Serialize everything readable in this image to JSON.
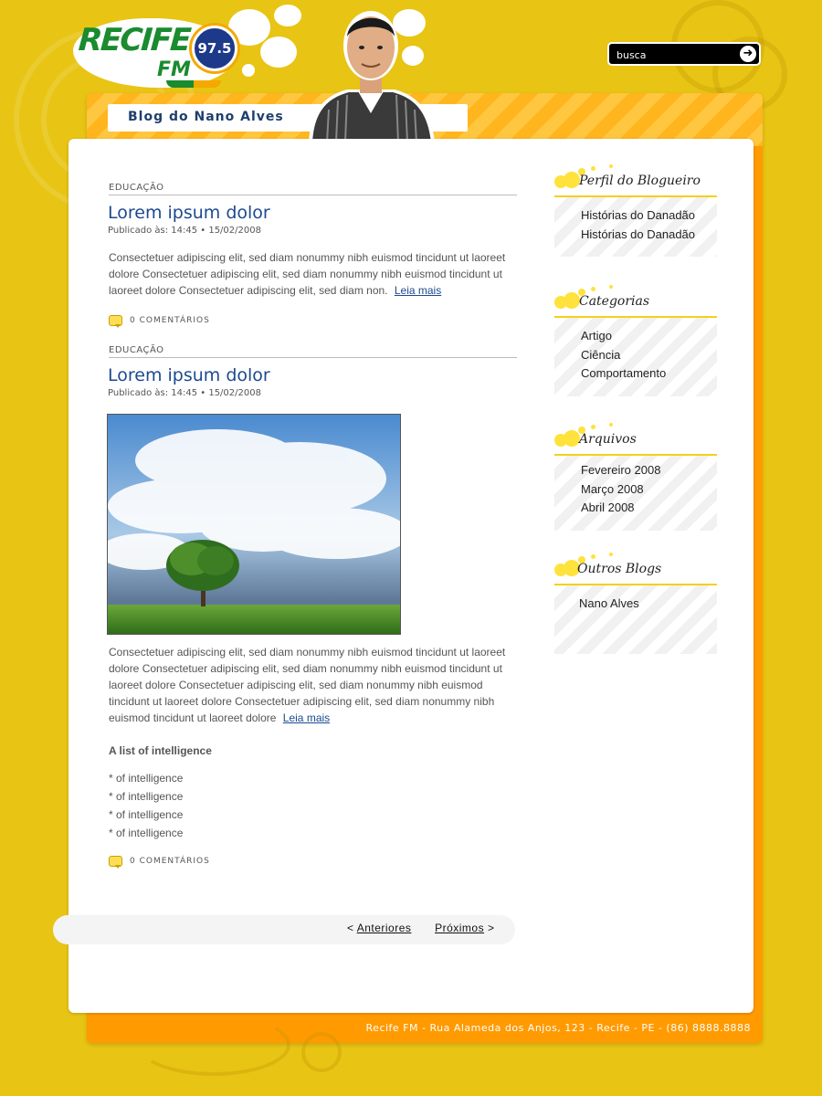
{
  "brand": {
    "logo_main": "RECIFE",
    "logo_sub": "FM",
    "frequency": "97.5"
  },
  "search": {
    "placeholder": "busca",
    "icon": "arrow-right-icon"
  },
  "header": {
    "blog_title": "Blog do Nano Alves"
  },
  "posts": [
    {
      "category": "EDUCAÇÃO",
      "title": "Lorem ipsum dolor",
      "meta": "Publicado às: 14:45 • 15/02/2008",
      "body": "Consectetuer adipiscing elit, sed diam nonummy nibh euismod tincidunt ut laoreet dolore Consectetuer adipiscing elit, sed diam nonummy nibh euismod tincidunt ut laoreet dolore Consectetuer adipiscing elit, sed diam non.",
      "read_more": "Leia mais",
      "comments": "0 COMENTÁRIOS"
    },
    {
      "category": "EDUCAÇÃO",
      "title": "Lorem ipsum dolor",
      "meta": "Publicado às: 14:45 • 15/02/2008",
      "body": "Consectetuer adipiscing elit, sed diam nonummy nibh euismod tincidunt ut laoreet dolore Consectetuer adipiscing elit, sed diam nonummy nibh euismod tincidunt ut laoreet dolore Consectetuer adipiscing elit, sed diam nonummy nibh euismod tincidunt ut laoreet dolore Consectetuer adipiscing elit, sed diam nonummy nibh euismod tincidunt ut laoreet dolore",
      "read_more": "Leia mais",
      "list_heading": "A list of intelligence",
      "list_items": [
        "* of intelligence",
        "* of intelligence",
        "* of intelligence",
        "* of intelligence"
      ],
      "comments": "0 COMENTÁRIOS"
    }
  ],
  "pagination": {
    "prev_arrow": "<",
    "prev": "Anteriores",
    "next": "Próximos",
    "next_arrow": ">"
  },
  "sidebar": {
    "widgets": [
      {
        "title": "Perfil do Blogueiro",
        "items": [
          "Histórias do Danadão",
          "Histórias do Danadão"
        ]
      },
      {
        "title": "Categorias",
        "items": [
          "Artigo",
          "Ciência",
          "Comportamento"
        ]
      },
      {
        "title": "Arquivos",
        "items": [
          "Fevereiro 2008",
          "Março 2008",
          "Abril 2008"
        ]
      },
      {
        "title": "Outros Blogs",
        "items": [
          "Nano Alves"
        ]
      }
    ]
  },
  "footer": {
    "text": "Recife FM - Rua Alameda dos Anjos, 123 - Recife - PE - (86) 8888.8888"
  },
  "colors": {
    "background": "#e8c414",
    "frame_orange": "#ff9a00",
    "title_blue": "#1c4a8f",
    "accent_yellow": "#f3d11a"
  }
}
